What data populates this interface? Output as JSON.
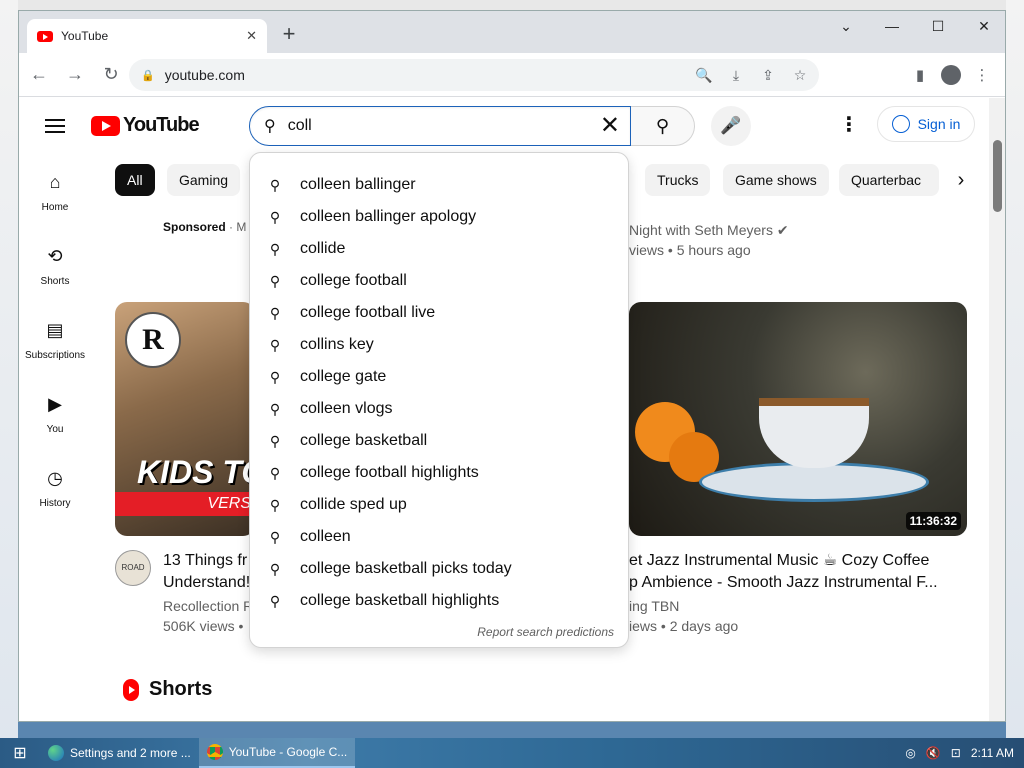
{
  "browser": {
    "tab_title": "YouTube",
    "tab_close": "✕",
    "new_tab": "+",
    "window_controls": {
      "collapse": "⌄",
      "minimize": "—",
      "maximize": "☐",
      "close": "✕"
    },
    "nav": {
      "back": "←",
      "forward": "→",
      "reload": "↻"
    },
    "address": "youtube.com",
    "omni_icons": {
      "zoom": "🔍",
      "install": "⤓",
      "share": "⇪",
      "bookmark": "☆"
    },
    "toolbar_icons": {
      "side_panel": "▮",
      "profile": "●",
      "menu": "⋮"
    }
  },
  "youtube": {
    "logo_text": "YouTube",
    "search": {
      "value": "coll",
      "clear": "✕",
      "search_icon": "⚲",
      "mic_icon": "🎤"
    },
    "more": "⋮",
    "signin_label": "Sign in",
    "sidebar": [
      {
        "label": "Home",
        "icon": "⌂"
      },
      {
        "label": "Shorts",
        "icon": "⟲"
      },
      {
        "label": "Subscriptions",
        "icon": "▤"
      },
      {
        "label": "You",
        "icon": "▶"
      },
      {
        "label": "History",
        "icon": "◷"
      }
    ],
    "chips": [
      "All",
      "Gaming",
      "Trucks",
      "Game shows",
      "Quarterbac"
    ],
    "chip_next": "›",
    "sponsored_label": "Sponsored",
    "sponsored_trail": "· M",
    "seth_channel": "Night with Seth Meyers ✔",
    "seth_meta": "views • 5 hours ago",
    "left_video": {
      "thumb_text": "KIDS TO",
      "thumb_banner": "VERS",
      "badge": "R",
      "avatar_text": "ROAD",
      "title_line1": "13 Things fr",
      "title_line2": "Understand!",
      "channel": "Recollection R",
      "meta": "506K views •"
    },
    "right_video": {
      "duration": "11:36:32",
      "title_line1": "et Jazz Instrumental Music ☕ Cozy Coffee",
      "title_line2": "p Ambience - Smooth Jazz Instrumental F...",
      "channel": "ing TBN",
      "meta": "iews • 2 days ago"
    },
    "shorts_label": "Shorts",
    "suggestions": [
      "colleen ballinger",
      "colleen ballinger apology",
      "collide",
      "college football",
      "college football live",
      "collins key",
      "college gate",
      "colleen vlogs",
      "college basketball",
      "college football highlights",
      "collide sped up",
      "colleen",
      "college basketball picks today",
      "college basketball highlights"
    ],
    "report_label": "Report search predictions"
  },
  "taskbar": {
    "start": "⊞",
    "items": [
      {
        "label": "Settings and 2 more ..."
      },
      {
        "label": "YouTube - Google C..."
      }
    ],
    "tray_time": "2:11 AM",
    "tray_icons": [
      "◎",
      "🔇",
      "⊡"
    ]
  }
}
